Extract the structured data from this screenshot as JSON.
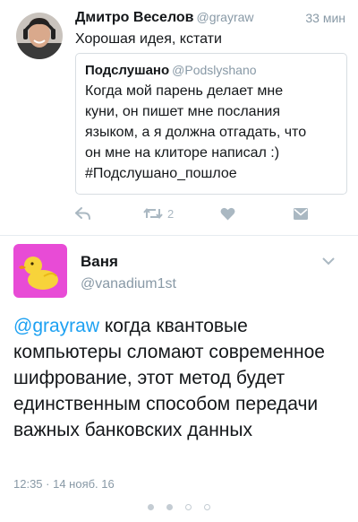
{
  "tweet1": {
    "author_name": "Дмитро Веселов",
    "author_handle": "@grayraw",
    "time": "33 мин",
    "text": "Хорошая идея, кстати",
    "quote": {
      "author_name": "Подслушано",
      "author_handle": "@Podslyshano",
      "text": "Когда мой парень делает мне\nкуни, он пишет мне послания\nязыком, а я должна отгадать, что\nон мне на клиторе написал :)\n#Подслушано_пошлое"
    },
    "actions": {
      "reply_icon": "reply-icon",
      "retweet_icon": "retweet-icon",
      "retweet_count": "2",
      "like_icon": "heart-icon",
      "dm_icon": "envelope-icon"
    }
  },
  "tweet2": {
    "author_name": "Ваня",
    "author_handle": "@vanadium1st",
    "mention": "@grayraw",
    "text": " когда квантовые компьютеры сломают современное шифрование, этот метод будет единственным способом передачи важных банковских данных",
    "meta": "12:35 · 14 нояб. 16",
    "menu_icon": "chevron-down-icon"
  },
  "pager": {
    "pages": 4,
    "current": 2
  },
  "colors": {
    "link": "#1da1f2",
    "secondary": "#8899a6",
    "avatar_bg": "#e84bd6",
    "duck": "#f7d33a"
  }
}
